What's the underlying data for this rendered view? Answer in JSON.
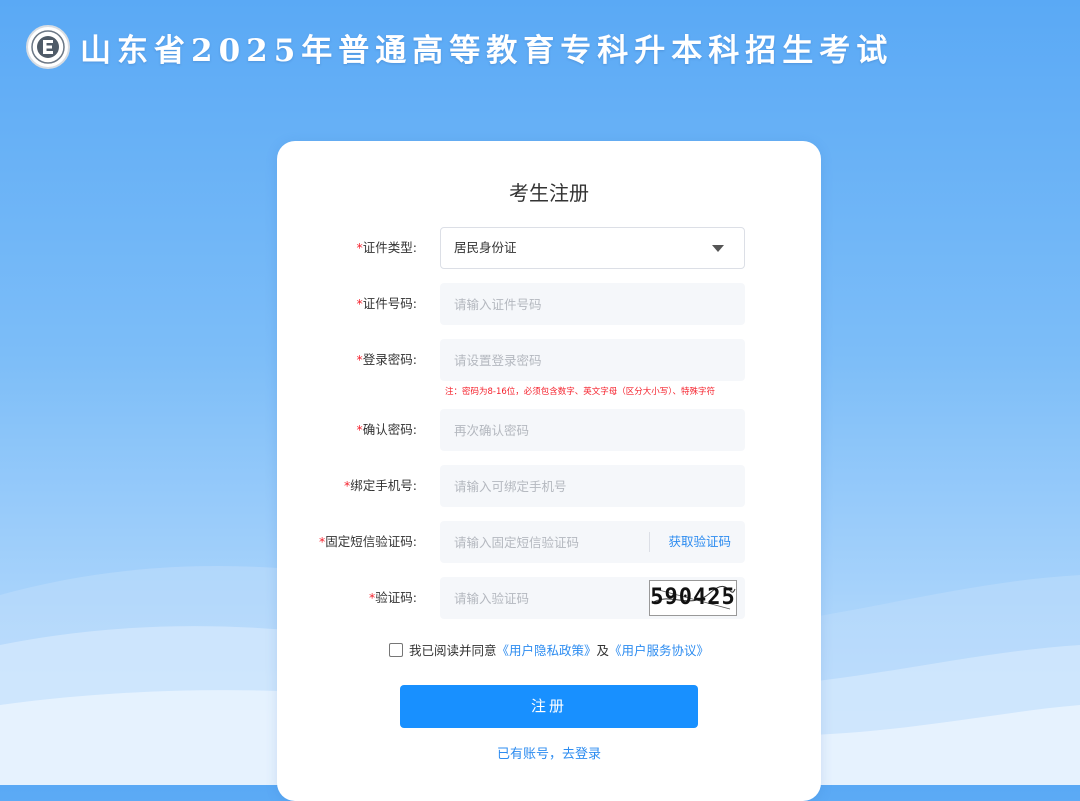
{
  "header": {
    "logo_icon": "exam-institute-seal-icon",
    "title": "山东省2025年普通高等教育专科升本科招生考试"
  },
  "form": {
    "title": "考生注册",
    "required_mark": "*",
    "id_type": {
      "label": "证件类型:",
      "value": "居民身份证"
    },
    "id_number": {
      "label": "证件号码:",
      "placeholder": "请输入证件号码"
    },
    "password": {
      "label": "登录密码:",
      "placeholder": "请设置登录密码",
      "note": "注：密码为8-16位，必须包含数字、英文字母（区分大小写）、特殊字符"
    },
    "confirm_password": {
      "label": "确认密码:",
      "placeholder": "再次确认密码"
    },
    "phone": {
      "label": "绑定手机号:",
      "placeholder": "请输入可绑定手机号"
    },
    "sms_code": {
      "label": "固定短信验证码:",
      "placeholder": "请输入固定短信验证码",
      "button": "获取验证码"
    },
    "captcha": {
      "label": "验证码:",
      "placeholder": "请输入验证码",
      "image_text": "590425"
    },
    "agreement": {
      "prefix": "我已阅读并同意",
      "privacy_link": "《用户隐私政策》",
      "and": "及",
      "service_link": "《用户服务协议》"
    },
    "submit_label": "注册",
    "login_link": "已有账号，去登录"
  },
  "colors": {
    "primary": "#1890ff",
    "link": "#2d8cf0",
    "required": "#f5222d",
    "background_top": "#5aa9f5"
  }
}
